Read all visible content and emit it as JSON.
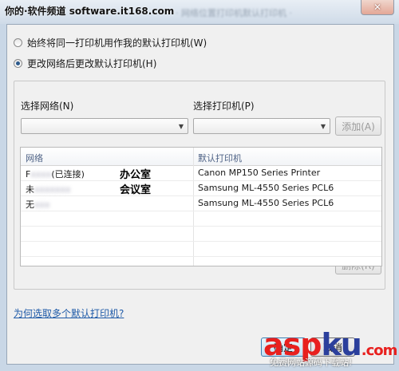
{
  "watermark_top": "你的·软件频道 software.it168.com",
  "title_text": "· 网络位置打印机默认打印机 ·",
  "close_label": "✕",
  "options": {
    "always_same": "始终将同一打印机用作我的默认打印机(W)",
    "change_on_network": "更改网络后更改默认打印机(H)"
  },
  "select_network": {
    "label": "选择网络(N)",
    "value": ""
  },
  "select_printer": {
    "label": "选择打印机(P)",
    "value": ""
  },
  "add_button": "添加(A)",
  "table": {
    "columns": [
      "网络",
      "默认打印机"
    ],
    "rows": [
      {
        "network_prefix": "F",
        "network_suffix": "(已连接)",
        "note": "办公室",
        "printer": "Canon MP150 Series Printer"
      },
      {
        "network_prefix": "未",
        "network_suffix": "",
        "note": "会议室",
        "printer": "Samsung ML-4550 Series PCL6"
      },
      {
        "network_prefix": "无",
        "network_suffix": "",
        "note": "",
        "printer": "Samsung ML-4550 Series PCL6"
      }
    ]
  },
  "delete_button": "删除(R)",
  "help_link": "为何选取多个默认打印机?",
  "ok_button": "确定",
  "cancel_button": "取消",
  "watermark_bottom": {
    "asp": "asp",
    "ku": "ku",
    "com": ".com",
    "sub": "免费网站源码下载站!"
  },
  "colors": {
    "link": "#1e5aa8",
    "watermark_red": "#e8201e",
    "watermark_blue": "#2b3f9c"
  }
}
